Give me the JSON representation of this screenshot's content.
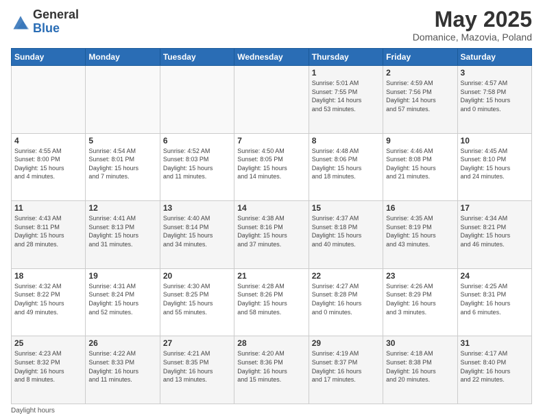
{
  "header": {
    "logo_general": "General",
    "logo_blue": "Blue",
    "month_title": "May 2025",
    "subtitle": "Domanice, Mazovia, Poland"
  },
  "days_of_week": [
    "Sunday",
    "Monday",
    "Tuesday",
    "Wednesday",
    "Thursday",
    "Friday",
    "Saturday"
  ],
  "weeks": [
    [
      {
        "day": "",
        "info": ""
      },
      {
        "day": "",
        "info": ""
      },
      {
        "day": "",
        "info": ""
      },
      {
        "day": "",
        "info": ""
      },
      {
        "day": "1",
        "info": "Sunrise: 5:01 AM\nSunset: 7:55 PM\nDaylight: 14 hours\nand 53 minutes."
      },
      {
        "day": "2",
        "info": "Sunrise: 4:59 AM\nSunset: 7:56 PM\nDaylight: 14 hours\nand 57 minutes."
      },
      {
        "day": "3",
        "info": "Sunrise: 4:57 AM\nSunset: 7:58 PM\nDaylight: 15 hours\nand 0 minutes."
      }
    ],
    [
      {
        "day": "4",
        "info": "Sunrise: 4:55 AM\nSunset: 8:00 PM\nDaylight: 15 hours\nand 4 minutes."
      },
      {
        "day": "5",
        "info": "Sunrise: 4:54 AM\nSunset: 8:01 PM\nDaylight: 15 hours\nand 7 minutes."
      },
      {
        "day": "6",
        "info": "Sunrise: 4:52 AM\nSunset: 8:03 PM\nDaylight: 15 hours\nand 11 minutes."
      },
      {
        "day": "7",
        "info": "Sunrise: 4:50 AM\nSunset: 8:05 PM\nDaylight: 15 hours\nand 14 minutes."
      },
      {
        "day": "8",
        "info": "Sunrise: 4:48 AM\nSunset: 8:06 PM\nDaylight: 15 hours\nand 18 minutes."
      },
      {
        "day": "9",
        "info": "Sunrise: 4:46 AM\nSunset: 8:08 PM\nDaylight: 15 hours\nand 21 minutes."
      },
      {
        "day": "10",
        "info": "Sunrise: 4:45 AM\nSunset: 8:10 PM\nDaylight: 15 hours\nand 24 minutes."
      }
    ],
    [
      {
        "day": "11",
        "info": "Sunrise: 4:43 AM\nSunset: 8:11 PM\nDaylight: 15 hours\nand 28 minutes."
      },
      {
        "day": "12",
        "info": "Sunrise: 4:41 AM\nSunset: 8:13 PM\nDaylight: 15 hours\nand 31 minutes."
      },
      {
        "day": "13",
        "info": "Sunrise: 4:40 AM\nSunset: 8:14 PM\nDaylight: 15 hours\nand 34 minutes."
      },
      {
        "day": "14",
        "info": "Sunrise: 4:38 AM\nSunset: 8:16 PM\nDaylight: 15 hours\nand 37 minutes."
      },
      {
        "day": "15",
        "info": "Sunrise: 4:37 AM\nSunset: 8:18 PM\nDaylight: 15 hours\nand 40 minutes."
      },
      {
        "day": "16",
        "info": "Sunrise: 4:35 AM\nSunset: 8:19 PM\nDaylight: 15 hours\nand 43 minutes."
      },
      {
        "day": "17",
        "info": "Sunrise: 4:34 AM\nSunset: 8:21 PM\nDaylight: 15 hours\nand 46 minutes."
      }
    ],
    [
      {
        "day": "18",
        "info": "Sunrise: 4:32 AM\nSunset: 8:22 PM\nDaylight: 15 hours\nand 49 minutes."
      },
      {
        "day": "19",
        "info": "Sunrise: 4:31 AM\nSunset: 8:24 PM\nDaylight: 15 hours\nand 52 minutes."
      },
      {
        "day": "20",
        "info": "Sunrise: 4:30 AM\nSunset: 8:25 PM\nDaylight: 15 hours\nand 55 minutes."
      },
      {
        "day": "21",
        "info": "Sunrise: 4:28 AM\nSunset: 8:26 PM\nDaylight: 15 hours\nand 58 minutes."
      },
      {
        "day": "22",
        "info": "Sunrise: 4:27 AM\nSunset: 8:28 PM\nDaylight: 16 hours\nand 0 minutes."
      },
      {
        "day": "23",
        "info": "Sunrise: 4:26 AM\nSunset: 8:29 PM\nDaylight: 16 hours\nand 3 minutes."
      },
      {
        "day": "24",
        "info": "Sunrise: 4:25 AM\nSunset: 8:31 PM\nDaylight: 16 hours\nand 6 minutes."
      }
    ],
    [
      {
        "day": "25",
        "info": "Sunrise: 4:23 AM\nSunset: 8:32 PM\nDaylight: 16 hours\nand 8 minutes."
      },
      {
        "day": "26",
        "info": "Sunrise: 4:22 AM\nSunset: 8:33 PM\nDaylight: 16 hours\nand 11 minutes."
      },
      {
        "day": "27",
        "info": "Sunrise: 4:21 AM\nSunset: 8:35 PM\nDaylight: 16 hours\nand 13 minutes."
      },
      {
        "day": "28",
        "info": "Sunrise: 4:20 AM\nSunset: 8:36 PM\nDaylight: 16 hours\nand 15 minutes."
      },
      {
        "day": "29",
        "info": "Sunrise: 4:19 AM\nSunset: 8:37 PM\nDaylight: 16 hours\nand 17 minutes."
      },
      {
        "day": "30",
        "info": "Sunrise: 4:18 AM\nSunset: 8:38 PM\nDaylight: 16 hours\nand 20 minutes."
      },
      {
        "day": "31",
        "info": "Sunrise: 4:17 AM\nSunset: 8:40 PM\nDaylight: 16 hours\nand 22 minutes."
      }
    ]
  ],
  "footer": {
    "note": "Daylight hours"
  }
}
